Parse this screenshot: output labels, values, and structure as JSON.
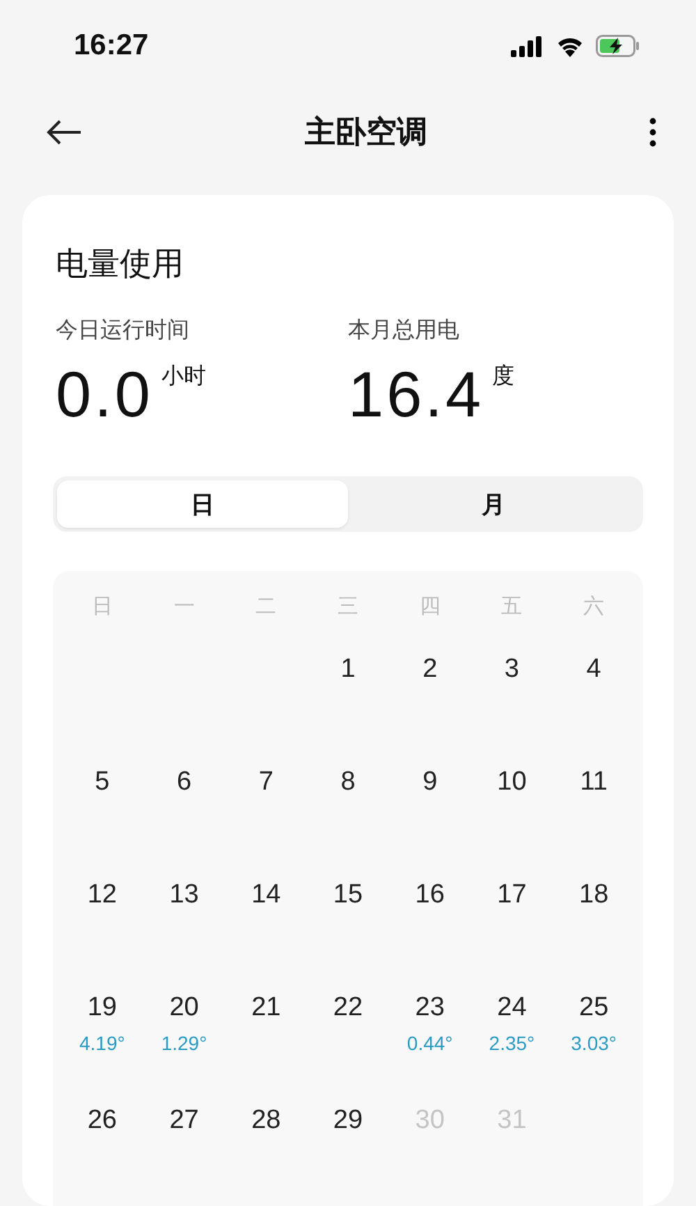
{
  "status_bar": {
    "time": "16:27"
  },
  "header": {
    "title": "主卧空调"
  },
  "card": {
    "title": "电量使用",
    "stats": [
      {
        "label": "今日运行时间",
        "value": "0.0",
        "unit": "小时"
      },
      {
        "label": "本月总用电",
        "value": "16.4",
        "unit": "度"
      }
    ],
    "tabs": [
      {
        "label": "日",
        "selected": true
      },
      {
        "label": "月",
        "selected": false
      }
    ],
    "calendar": {
      "weekdays": [
        "日",
        "一",
        "二",
        "三",
        "四",
        "五",
        "六"
      ],
      "weeks": [
        [
          {
            "day": "1",
            "disabled": false
          },
          {
            "day": "2",
            "disabled": false
          },
          {
            "day": "3",
            "disabled": false
          },
          {
            "day": "4",
            "disabled": false
          }
        ],
        [
          {
            "day": "5",
            "disabled": false
          },
          {
            "day": "6",
            "disabled": false
          },
          {
            "day": "7",
            "disabled": false
          },
          {
            "day": "8",
            "disabled": false
          },
          {
            "day": "9",
            "disabled": false
          },
          {
            "day": "10",
            "disabled": false
          },
          {
            "day": "11",
            "disabled": false
          }
        ],
        [
          {
            "day": "12",
            "disabled": false
          },
          {
            "day": "13",
            "disabled": false
          },
          {
            "day": "14",
            "disabled": false
          },
          {
            "day": "15",
            "disabled": false
          },
          {
            "day": "16",
            "disabled": false
          },
          {
            "day": "17",
            "disabled": false
          },
          {
            "day": "18",
            "disabled": false
          }
        ],
        [
          {
            "day": "19",
            "usage": "4.19°",
            "disabled": false
          },
          {
            "day": "20",
            "usage": "1.29°",
            "disabled": false
          },
          {
            "day": "21",
            "disabled": false
          },
          {
            "day": "22",
            "disabled": false
          },
          {
            "day": "23",
            "usage": "0.44°",
            "disabled": false
          },
          {
            "day": "24",
            "usage": "2.35°",
            "disabled": false
          },
          {
            "day": "25",
            "usage": "3.03°",
            "disabled": false
          }
        ],
        [
          {
            "day": "26",
            "disabled": false
          },
          {
            "day": "27",
            "disabled": false
          },
          {
            "day": "28",
            "disabled": false
          },
          {
            "day": "29",
            "disabled": false
          },
          {
            "day": "30",
            "disabled": true
          },
          {
            "day": "31",
            "disabled": true
          }
        ]
      ]
    }
  }
}
